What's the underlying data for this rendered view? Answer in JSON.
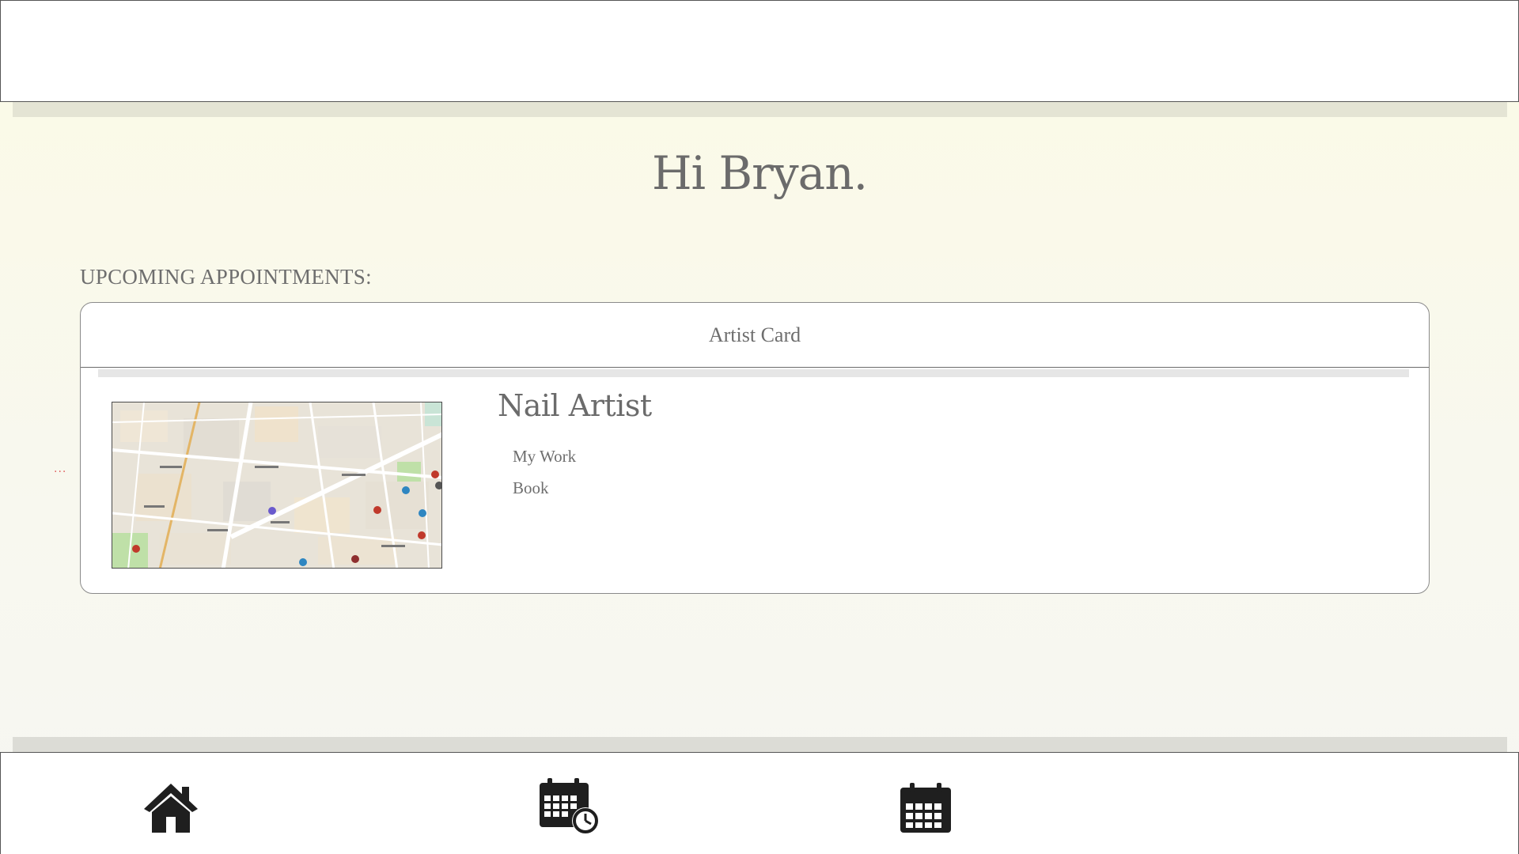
{
  "greeting": "Hi Bryan.",
  "upcoming": {
    "section_title": "UPCOMING APPOINTMENTS:"
  },
  "card": {
    "header": "Artist Card",
    "title": "Nail Artist",
    "links": {
      "my_work": "My Work",
      "book": "Book"
    },
    "map_image": "map-thumbnail"
  },
  "indicator": "...",
  "nav": {
    "icons": [
      "home-icon",
      "calendar-clock-icon",
      "calendar-icon"
    ]
  },
  "colors": {
    "background": "#fbfae6",
    "text": "#6b6b6b",
    "indicator": "#e06060"
  }
}
